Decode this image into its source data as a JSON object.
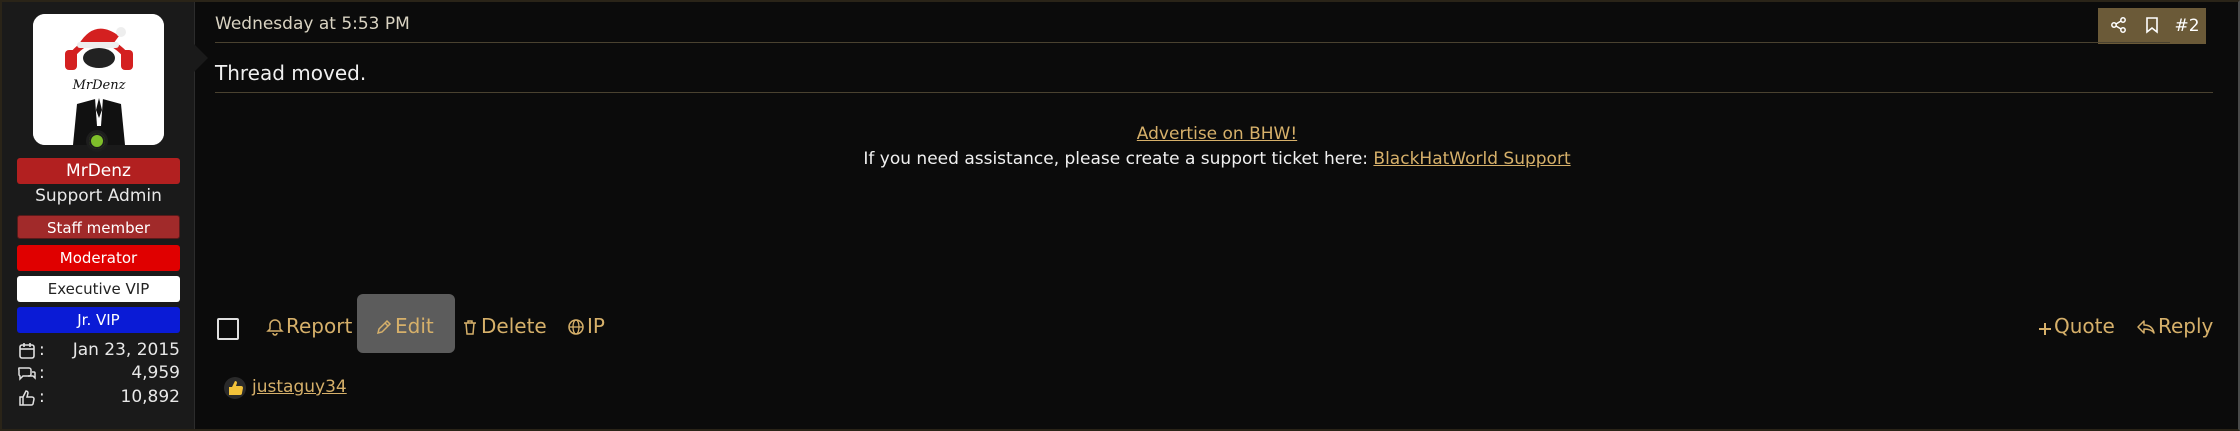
{
  "user": {
    "name": "MrDenz",
    "title": "Support Admin",
    "avatar_text": "MrDenz",
    "badges": {
      "staff": "Staff member",
      "moderator": "Moderator",
      "executive": "Executive VIP",
      "jr_vip": "Jr. VIP"
    },
    "stats": {
      "joined": "Jan 23, 2015",
      "messages": "4,959",
      "reactions": "10,892"
    },
    "colon": ":"
  },
  "post": {
    "date": "Wednesday at 5:53 PM",
    "number": "#2",
    "content": "Thread moved.",
    "advert": "Advertise on BHW!",
    "support_text": "If you need assistance, please create a support ticket here: ",
    "support_link": "BlackHatWorld Support"
  },
  "actions": {
    "report": "Report",
    "edit": "Edit",
    "delete": "Delete",
    "ip": "IP",
    "quote": "Quote",
    "reply": "Reply"
  },
  "reactions": {
    "user": "justaguy34"
  },
  "colors": {
    "accent": "#d6b06a",
    "name_badge": "#b22020",
    "moderator": "#e00000",
    "jr_vip": "#0a1bd6",
    "toolbar": "#6b5a38"
  }
}
